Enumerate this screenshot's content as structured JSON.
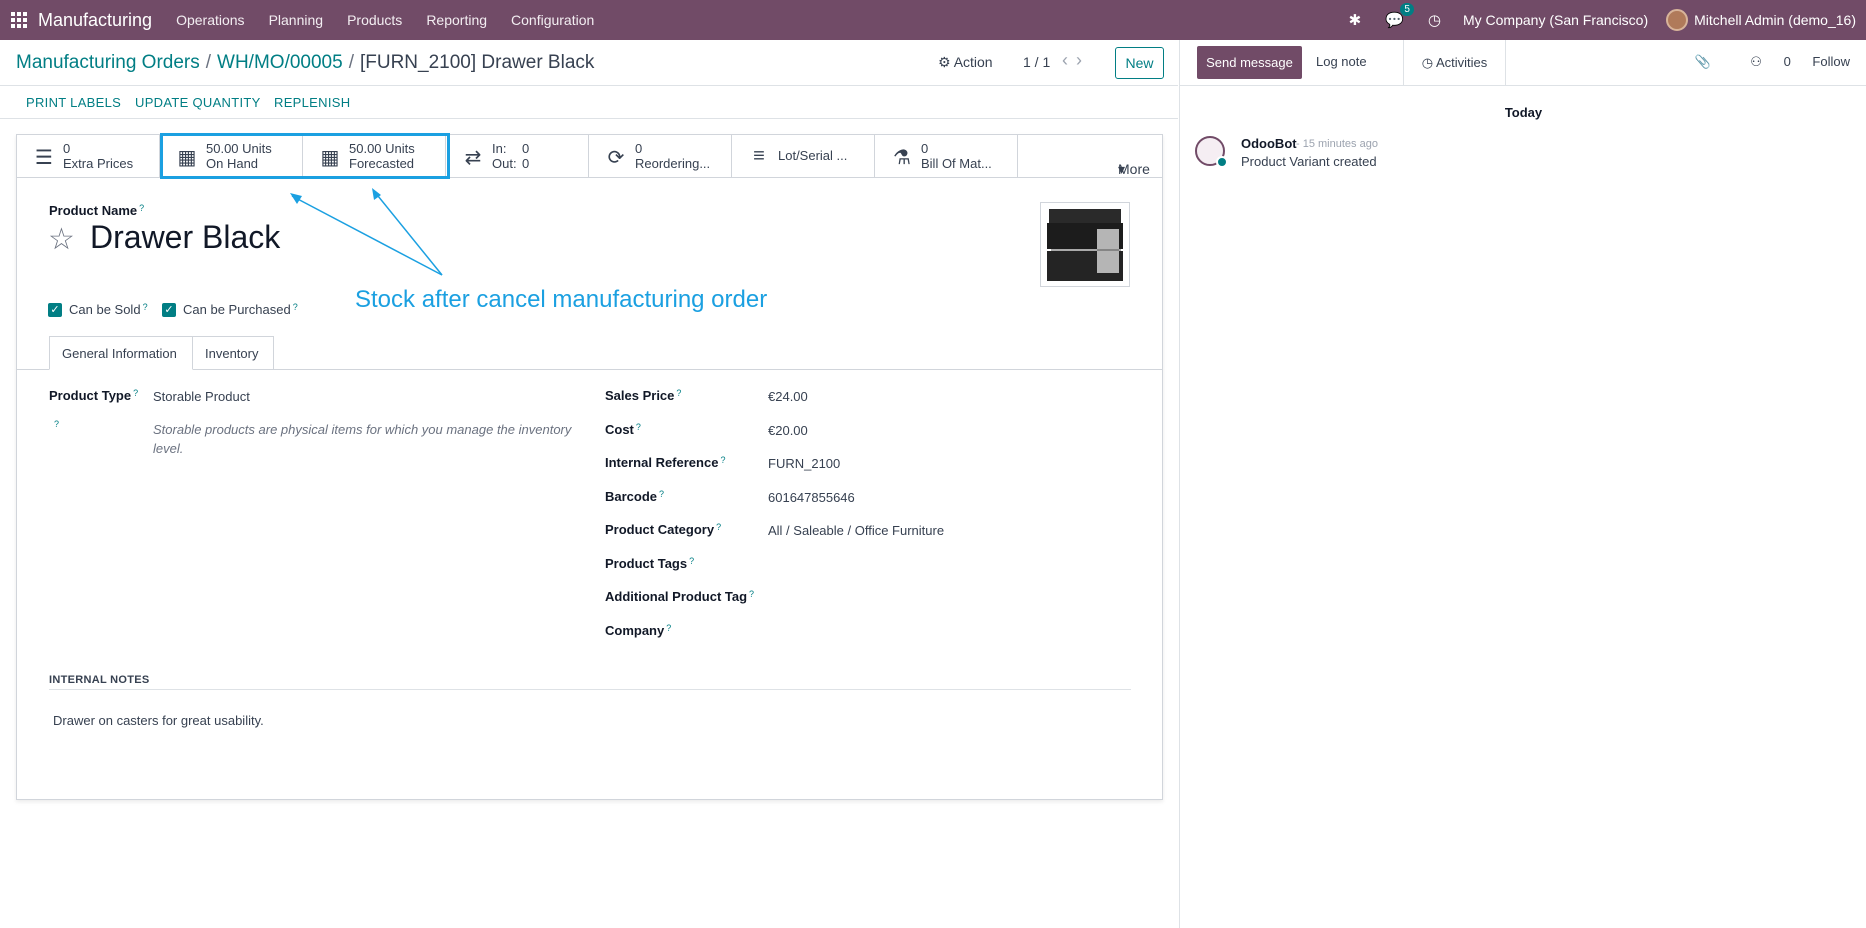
{
  "navbar": {
    "brand": "Manufacturing",
    "menus": [
      "Operations",
      "Planning",
      "Products",
      "Reporting",
      "Configuration"
    ],
    "message_count": "5",
    "company": "My Company (San Francisco)",
    "user": "Mitchell Admin (demo_16)"
  },
  "breadcrumb": {
    "root": "Manufacturing Orders",
    "mid": "WH/MO/00005",
    "current": "[FURN_2100] Drawer Black"
  },
  "control": {
    "action": "Action",
    "pager": "1 / 1",
    "new": "New"
  },
  "actions": [
    "PRINT LABELS",
    "UPDATE QUANTITY",
    "REPLENISH"
  ],
  "stats": {
    "extra_prices": {
      "value": "0",
      "label": "Extra Prices"
    },
    "on_hand": {
      "value": "50.00 Units",
      "label": "On Hand"
    },
    "forecasted": {
      "value": "50.00 Units",
      "label": "Forecasted"
    },
    "in_out": {
      "in_label": "In:",
      "in_value": "0",
      "out_label": "Out:",
      "out_value": "0"
    },
    "reordering": {
      "value": "0",
      "label": "Reordering..."
    },
    "lot_serial": {
      "label": "Lot/Serial ..."
    },
    "bom": {
      "value": "0",
      "label": "Bill Of Mat..."
    },
    "more": "More"
  },
  "product": {
    "name_label": "Product Name",
    "name": "Drawer Black",
    "can_be_sold": "Can be Sold",
    "can_be_purchased": "Can be Purchased"
  },
  "annotation": "Stock after cancel manufacturing order",
  "tabs": [
    "General Information",
    "Inventory"
  ],
  "general": {
    "product_type_label": "Product Type",
    "product_type": "Storable Product",
    "product_type_help": "Storable products are physical items for which you manage the inventory level.",
    "sales_price_label": "Sales Price",
    "sales_price": "€24.00",
    "cost_label": "Cost",
    "cost": "€20.00",
    "internal_ref_label": "Internal Reference",
    "internal_ref": "FURN_2100",
    "barcode_label": "Barcode",
    "barcode": "601647855646",
    "category_label": "Product Category",
    "category": "All / Saleable / Office Furniture",
    "tags_label": "Product Tags",
    "additional_tag_label": "Additional Product Tag",
    "company_label": "Company"
  },
  "notes": {
    "header": "INTERNAL NOTES",
    "text": "Drawer on casters for great usability."
  },
  "chatter": {
    "send_message": "Send message",
    "log_note": "Log note",
    "activities": "Activities",
    "followers_count": "0",
    "follow": "Follow",
    "today": "Today",
    "author": "OdooBot",
    "time": "- 15 minutes ago",
    "message": "Product Variant created"
  },
  "colors": {
    "brand": "#714b67",
    "accent": "#017e84",
    "annotation": "#1ba0e1"
  }
}
